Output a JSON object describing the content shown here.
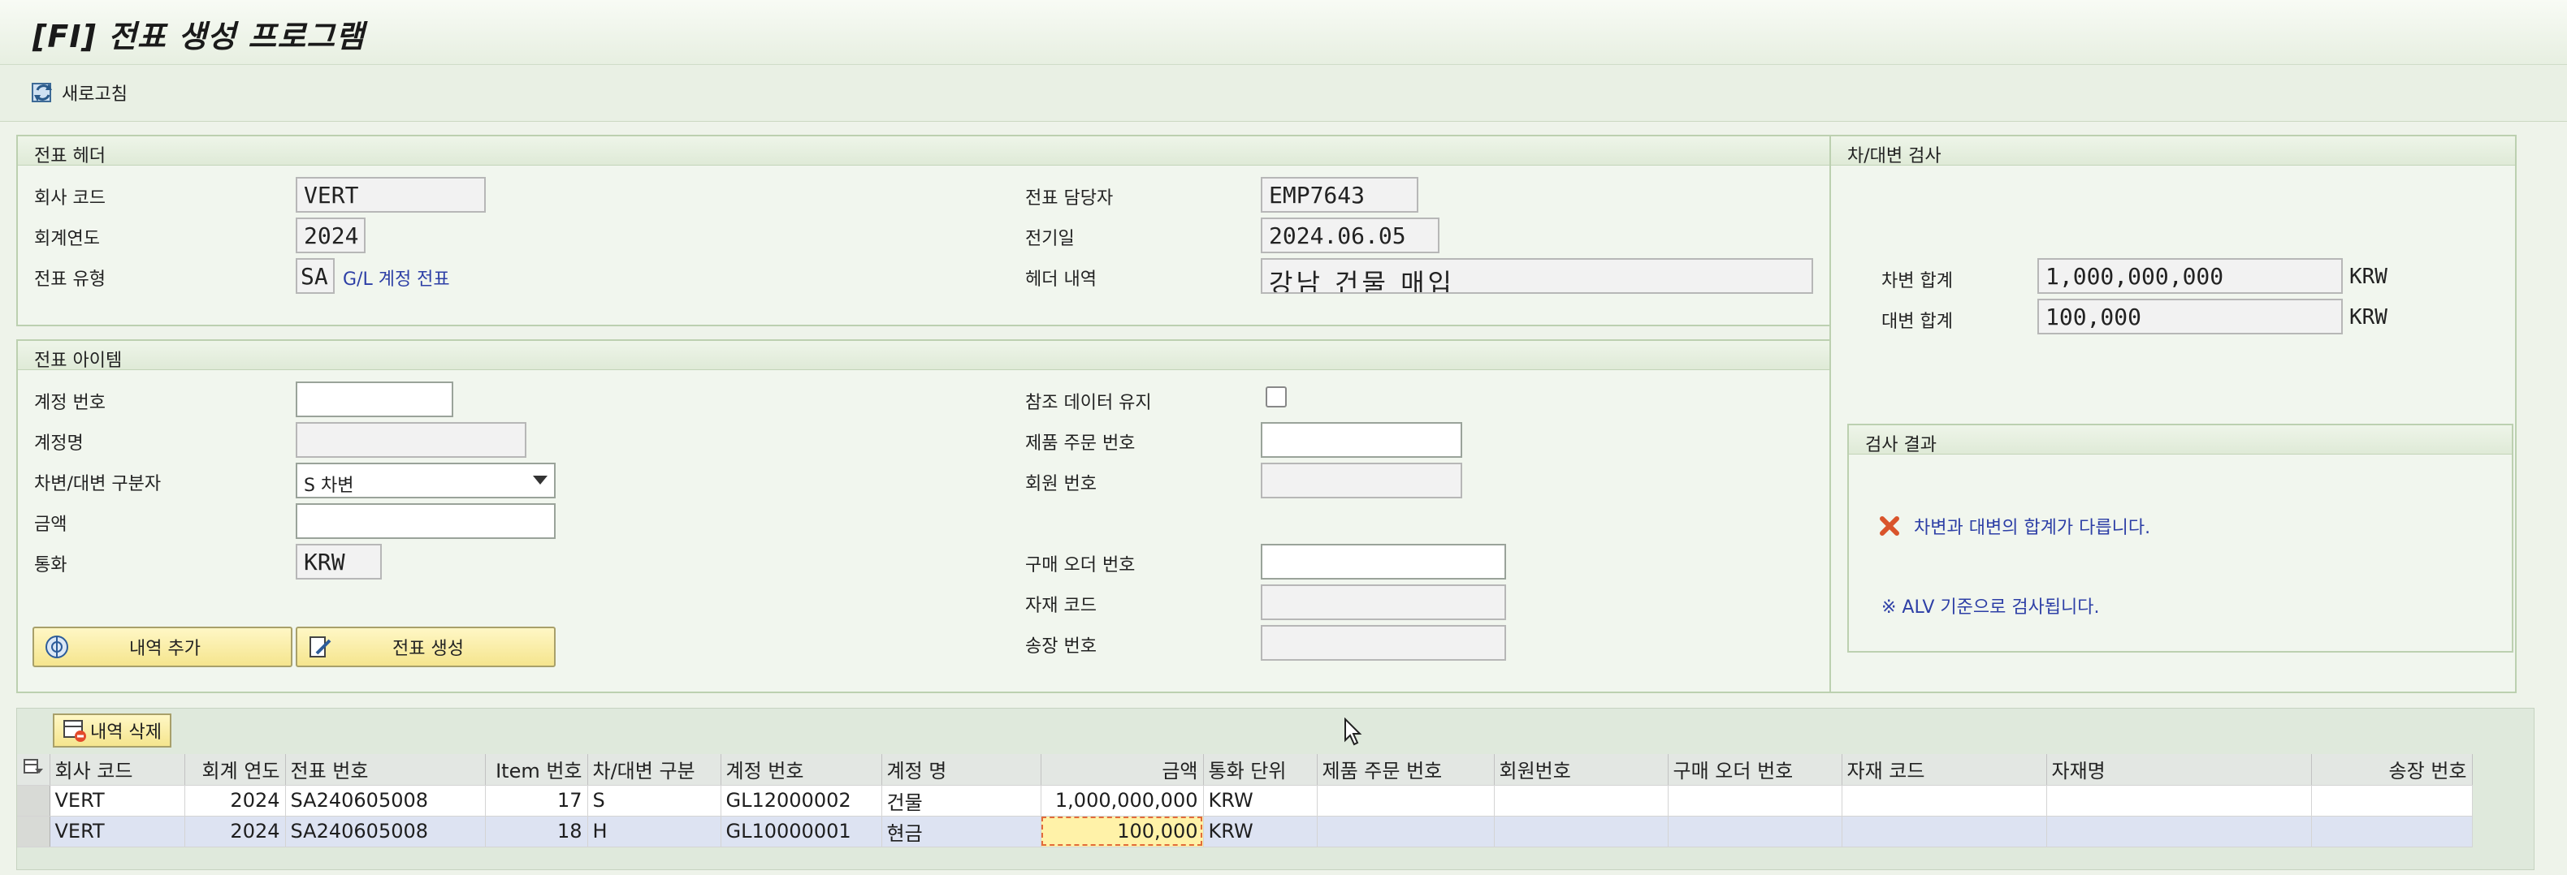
{
  "app": {
    "title": "[FI] 전표 생성 프로그램"
  },
  "toolbar": {
    "refresh_label": "새로고침"
  },
  "header_section": {
    "title": "전표 헤더",
    "company_code_label": "회사 코드",
    "company_code": "VERT",
    "fiscal_year_label": "회계연도",
    "fiscal_year": "2024",
    "doc_type_label": "전표 유형",
    "doc_type": "SA",
    "doc_type_text": "G/L 계정 전표",
    "owner_label": "전표 담당자",
    "owner": "EMP7643",
    "posting_date_label": "전기일",
    "posting_date": "2024.06.05",
    "header_text_label": "헤더 내역",
    "header_text": "강남 건물 매입"
  },
  "item_section": {
    "title": "전표 아이템",
    "account_no_label": "계정 번호",
    "account_no": "",
    "account_name_label": "계정명",
    "account_name": "",
    "dc_label": "차변/대변 구분자",
    "dc_value": "S 차변",
    "amount_label": "금액",
    "amount": "",
    "currency_label": "통화",
    "currency": "KRW",
    "keep_ref_label": "참조 데이터 유지",
    "prod_order_label": "제품 주문 번호",
    "member_no_label": "회원 번호",
    "po_no_label": "구매 오더 번호",
    "material_label": "자재 코드",
    "invoice_label": "송장 번호",
    "add_button": "내역 추가",
    "create_button": "전표 생성"
  },
  "balance_section": {
    "title": "차/대변 검사",
    "debit_label": "차변 합계",
    "debit_total": "1,000,000,000",
    "debit_currency": "KRW",
    "credit_label": "대변 합계",
    "credit_total": "100,000",
    "credit_currency": "KRW"
  },
  "result_section": {
    "title": "검사 결과",
    "error_message": "차변과 대변의 합계가 다릅니다.",
    "note_message": "※ ALV 기준으로 검사됩니다."
  },
  "grid": {
    "delete_button": "내역 삭제",
    "columns": [
      "회사 코드",
      "회계 연도",
      "전표 번호",
      "Item 번호",
      "차/대변 구분",
      "계정 번호",
      "계정 명",
      "금액",
      "통화 단위",
      "제품 주문 번호",
      "회원번호",
      "구매 오더 번호",
      "자재 코드",
      "자재명",
      "송장 번호"
    ],
    "rows": [
      [
        "VERT",
        "2024",
        "SA240605008",
        "17",
        "S",
        "GL12000002",
        "건물",
        "1,000,000,000",
        "KRW",
        "",
        "",
        "",
        "",
        "",
        ""
      ],
      [
        "VERT",
        "2024",
        "SA240605008",
        "18",
        "H",
        "GL10000001",
        "현금",
        "100,000",
        "KRW",
        "",
        "",
        "",
        "",
        "",
        ""
      ]
    ]
  },
  "colors": {
    "accent": "#2d3fa6",
    "error": "#d9542b",
    "button_bg": "#f5e58e",
    "selected_row": "#dde3f2"
  }
}
